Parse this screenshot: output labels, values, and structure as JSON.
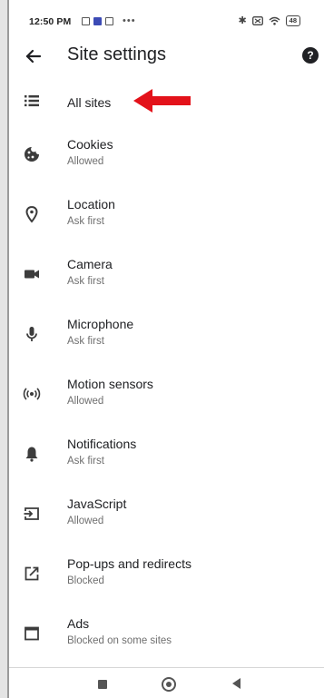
{
  "status_bar": {
    "time": "12:50 PM",
    "dots": "•••",
    "battery": "48"
  },
  "header": {
    "title": "Site settings",
    "help_glyph": "?",
    "back_icon": "arrow-left-icon"
  },
  "settings": [
    {
      "icon": "list-icon",
      "label": "All sites",
      "status": ""
    },
    {
      "icon": "cookie-icon",
      "label": "Cookies",
      "status": "Allowed"
    },
    {
      "icon": "location-pin-icon",
      "label": "Location",
      "status": "Ask first"
    },
    {
      "icon": "videocam-icon",
      "label": "Camera",
      "status": "Ask first"
    },
    {
      "icon": "mic-icon",
      "label": "Microphone",
      "status": "Ask first"
    },
    {
      "icon": "sensors-icon",
      "label": "Motion sensors",
      "status": "Allowed"
    },
    {
      "icon": "bell-icon",
      "label": "Notifications",
      "status": "Ask first"
    },
    {
      "icon": "javascript-icon",
      "label": "JavaScript",
      "status": "Allowed"
    },
    {
      "icon": "open-in-new-icon",
      "label": "Pop-ups and redirects",
      "status": "Blocked"
    },
    {
      "icon": "ads-window-icon",
      "label": "Ads",
      "status": "Blocked on some sites"
    }
  ],
  "annotation": {
    "icon": "red-arrow-icon",
    "color": "#e3121a"
  },
  "nav_bar": {
    "recent_icon": "square-icon",
    "home_icon": "circle-home-icon",
    "back_icon": "triangle-back-icon"
  },
  "colors": {
    "text_primary": "#202124",
    "text_secondary": "#6f6f6f",
    "icon": "#3c3c3c"
  }
}
